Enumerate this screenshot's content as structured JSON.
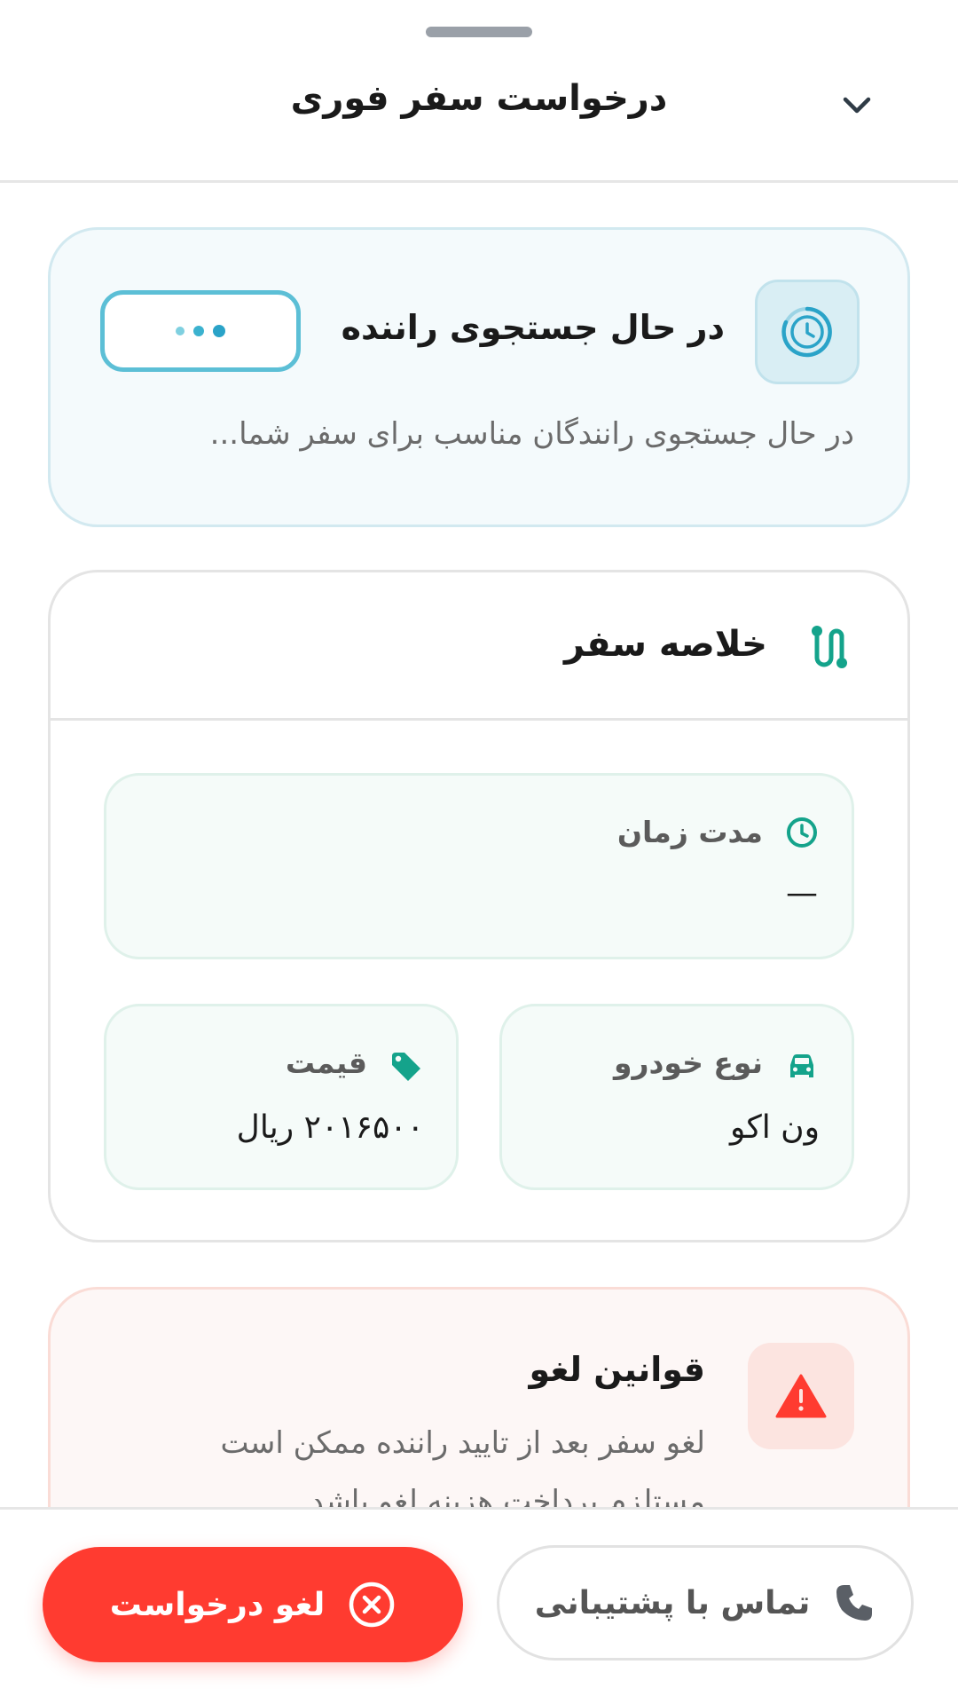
{
  "header": {
    "title": "درخواست سفر فوری"
  },
  "search": {
    "title": "در حال جستجوی راننده",
    "subtitle": "در حال جستجوی رانندگان مناسب برای سفر شما..."
  },
  "summary": {
    "title": "خلاصه سفر",
    "duration": {
      "label": "مدت زمان",
      "value": "—"
    },
    "vehicle": {
      "label": "نوع خودرو",
      "value": "ون اکو"
    },
    "price": {
      "label": "قیمت",
      "value": "۲۰۱۶۵۰۰ ریال"
    }
  },
  "rules": {
    "title": "قوانین لغو",
    "text": "لغو سفر بعد از تایید راننده ممکن است مستلزم پرداخت هزینه لغو باشد"
  },
  "actions": {
    "support_label": "تماس با پشتیبانی",
    "cancel_label": "لغو درخواست"
  },
  "icons": {
    "collapse": "chevron-down-icon",
    "searching": "clock-icon",
    "summary": "route-icon",
    "duration": "clock-icon",
    "vehicle": "car-icon",
    "price": "tag-icon",
    "rules": "warning-icon",
    "support": "phone-icon",
    "cancel": "cancel-circle-icon"
  },
  "colors": {
    "accent_teal": "#14a38b",
    "accent_blue": "#2aa3c8",
    "danger": "#ff3b30"
  }
}
